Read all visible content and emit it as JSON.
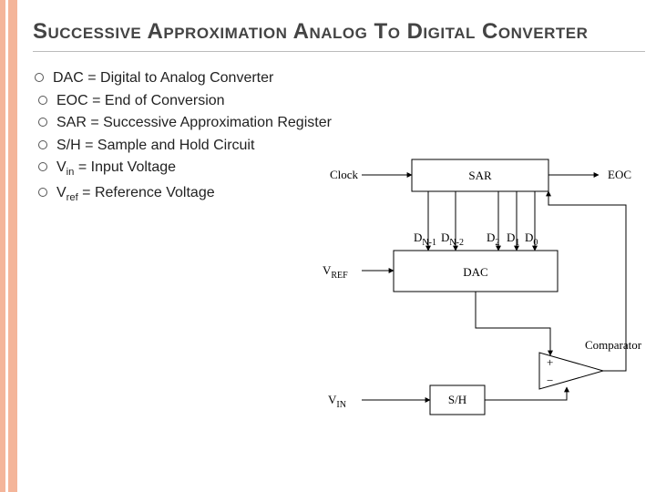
{
  "title": "Successive Approximation Analog To Digital Converter",
  "bullets": [
    "DAC = Digital to Analog Converter",
    "EOC = End of Conversion",
    "SAR = Successive Approximation Register",
    "S/H = Sample and Hold Circuit",
    "V_in = Input Voltage",
    "V_ref = Reference Voltage"
  ],
  "diagram": {
    "clock": "Clock",
    "sar": "SAR",
    "eoc": "EOC",
    "dac": "DAC",
    "vref": "V",
    "vref_sub": "REF",
    "vin": "V",
    "vin_sub": "IN",
    "sh": "S/H",
    "comparator": "Comparator",
    "bits": {
      "dn1": "D",
      "dn1_sub": "N-1",
      "dn2": "D",
      "dn2_sub": "N-2",
      "d2": "D",
      "d2_sub": "2",
      "d1": "D",
      "d1_sub": "1",
      "d0": "D",
      "d0_sub": "0"
    }
  }
}
